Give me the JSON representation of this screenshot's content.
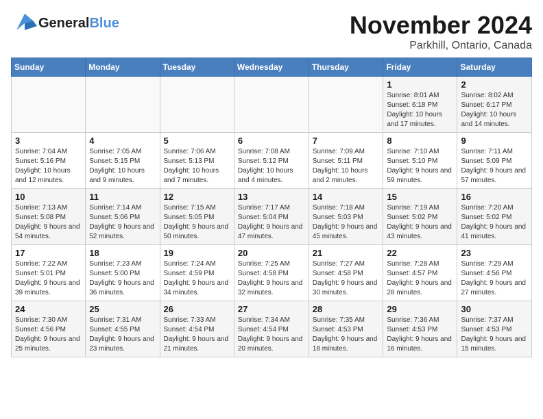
{
  "header": {
    "logo_general": "General",
    "logo_blue": "Blue",
    "month": "November 2024",
    "location": "Parkhill, Ontario, Canada"
  },
  "weekdays": [
    "Sunday",
    "Monday",
    "Tuesday",
    "Wednesday",
    "Thursday",
    "Friday",
    "Saturday"
  ],
  "weeks": [
    [
      {
        "day": "",
        "info": ""
      },
      {
        "day": "",
        "info": ""
      },
      {
        "day": "",
        "info": ""
      },
      {
        "day": "",
        "info": ""
      },
      {
        "day": "",
        "info": ""
      },
      {
        "day": "1",
        "info": "Sunrise: 8:01 AM\nSunset: 6:18 PM\nDaylight: 10 hours and 17 minutes."
      },
      {
        "day": "2",
        "info": "Sunrise: 8:02 AM\nSunset: 6:17 PM\nDaylight: 10 hours and 14 minutes."
      }
    ],
    [
      {
        "day": "3",
        "info": "Sunrise: 7:04 AM\nSunset: 5:16 PM\nDaylight: 10 hours and 12 minutes."
      },
      {
        "day": "4",
        "info": "Sunrise: 7:05 AM\nSunset: 5:15 PM\nDaylight: 10 hours and 9 minutes."
      },
      {
        "day": "5",
        "info": "Sunrise: 7:06 AM\nSunset: 5:13 PM\nDaylight: 10 hours and 7 minutes."
      },
      {
        "day": "6",
        "info": "Sunrise: 7:08 AM\nSunset: 5:12 PM\nDaylight: 10 hours and 4 minutes."
      },
      {
        "day": "7",
        "info": "Sunrise: 7:09 AM\nSunset: 5:11 PM\nDaylight: 10 hours and 2 minutes."
      },
      {
        "day": "8",
        "info": "Sunrise: 7:10 AM\nSunset: 5:10 PM\nDaylight: 9 hours and 59 minutes."
      },
      {
        "day": "9",
        "info": "Sunrise: 7:11 AM\nSunset: 5:09 PM\nDaylight: 9 hours and 57 minutes."
      }
    ],
    [
      {
        "day": "10",
        "info": "Sunrise: 7:13 AM\nSunset: 5:08 PM\nDaylight: 9 hours and 54 minutes."
      },
      {
        "day": "11",
        "info": "Sunrise: 7:14 AM\nSunset: 5:06 PM\nDaylight: 9 hours and 52 minutes."
      },
      {
        "day": "12",
        "info": "Sunrise: 7:15 AM\nSunset: 5:05 PM\nDaylight: 9 hours and 50 minutes."
      },
      {
        "day": "13",
        "info": "Sunrise: 7:17 AM\nSunset: 5:04 PM\nDaylight: 9 hours and 47 minutes."
      },
      {
        "day": "14",
        "info": "Sunrise: 7:18 AM\nSunset: 5:03 PM\nDaylight: 9 hours and 45 minutes."
      },
      {
        "day": "15",
        "info": "Sunrise: 7:19 AM\nSunset: 5:02 PM\nDaylight: 9 hours and 43 minutes."
      },
      {
        "day": "16",
        "info": "Sunrise: 7:20 AM\nSunset: 5:02 PM\nDaylight: 9 hours and 41 minutes."
      }
    ],
    [
      {
        "day": "17",
        "info": "Sunrise: 7:22 AM\nSunset: 5:01 PM\nDaylight: 9 hours and 39 minutes."
      },
      {
        "day": "18",
        "info": "Sunrise: 7:23 AM\nSunset: 5:00 PM\nDaylight: 9 hours and 36 minutes."
      },
      {
        "day": "19",
        "info": "Sunrise: 7:24 AM\nSunset: 4:59 PM\nDaylight: 9 hours and 34 minutes."
      },
      {
        "day": "20",
        "info": "Sunrise: 7:25 AM\nSunset: 4:58 PM\nDaylight: 9 hours and 32 minutes."
      },
      {
        "day": "21",
        "info": "Sunrise: 7:27 AM\nSunset: 4:58 PM\nDaylight: 9 hours and 30 minutes."
      },
      {
        "day": "22",
        "info": "Sunrise: 7:28 AM\nSunset: 4:57 PM\nDaylight: 9 hours and 28 minutes."
      },
      {
        "day": "23",
        "info": "Sunrise: 7:29 AM\nSunset: 4:56 PM\nDaylight: 9 hours and 27 minutes."
      }
    ],
    [
      {
        "day": "24",
        "info": "Sunrise: 7:30 AM\nSunset: 4:56 PM\nDaylight: 9 hours and 25 minutes."
      },
      {
        "day": "25",
        "info": "Sunrise: 7:31 AM\nSunset: 4:55 PM\nDaylight: 9 hours and 23 minutes."
      },
      {
        "day": "26",
        "info": "Sunrise: 7:33 AM\nSunset: 4:54 PM\nDaylight: 9 hours and 21 minutes."
      },
      {
        "day": "27",
        "info": "Sunrise: 7:34 AM\nSunset: 4:54 PM\nDaylight: 9 hours and 20 minutes."
      },
      {
        "day": "28",
        "info": "Sunrise: 7:35 AM\nSunset: 4:53 PM\nDaylight: 9 hours and 18 minutes."
      },
      {
        "day": "29",
        "info": "Sunrise: 7:36 AM\nSunset: 4:53 PM\nDaylight: 9 hours and 16 minutes."
      },
      {
        "day": "30",
        "info": "Sunrise: 7:37 AM\nSunset: 4:53 PM\nDaylight: 9 hours and 15 minutes."
      }
    ]
  ]
}
